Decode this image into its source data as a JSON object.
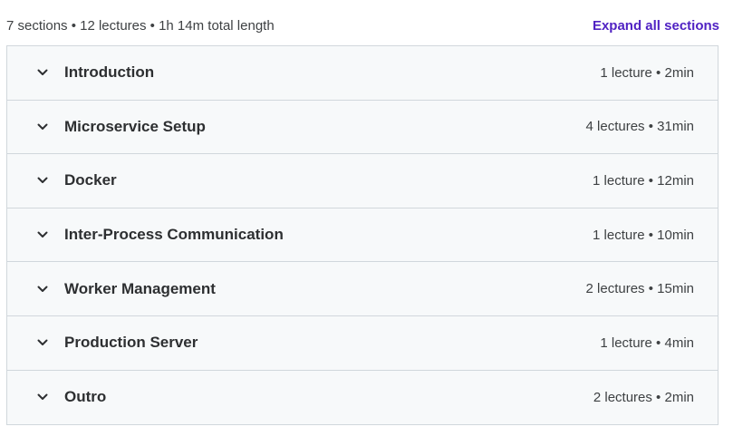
{
  "summary": {
    "text": "7 sections • 12 lectures • 1h 14m total length",
    "expand_all_label": "Expand all sections"
  },
  "sections": [
    {
      "title": "Introduction",
      "meta": "1 lecture • 2min",
      "chevron_icon": "chevron-down-icon"
    },
    {
      "title": "Microservice Setup",
      "meta": "4 lectures • 31min",
      "chevron_icon": "chevron-down-icon"
    },
    {
      "title": "Docker",
      "meta": "1 lecture • 12min",
      "chevron_icon": "chevron-down-icon"
    },
    {
      "title": "Inter-Process Communication",
      "meta": "1 lecture • 10min",
      "chevron_icon": "chevron-down-icon"
    },
    {
      "title": "Worker Management",
      "meta": "2 lectures • 15min",
      "chevron_icon": "chevron-down-icon"
    },
    {
      "title": "Production Server",
      "meta": "1 lecture • 4min",
      "chevron_icon": "chevron-down-icon"
    },
    {
      "title": "Outro",
      "meta": "2 lectures • 2min",
      "chevron_icon": "chevron-down-icon"
    }
  ],
  "colors": {
    "accent": "#5022c3",
    "section_background": "#f7f9fa",
    "border": "#d1d7dc",
    "text_primary": "#2d2f31"
  }
}
